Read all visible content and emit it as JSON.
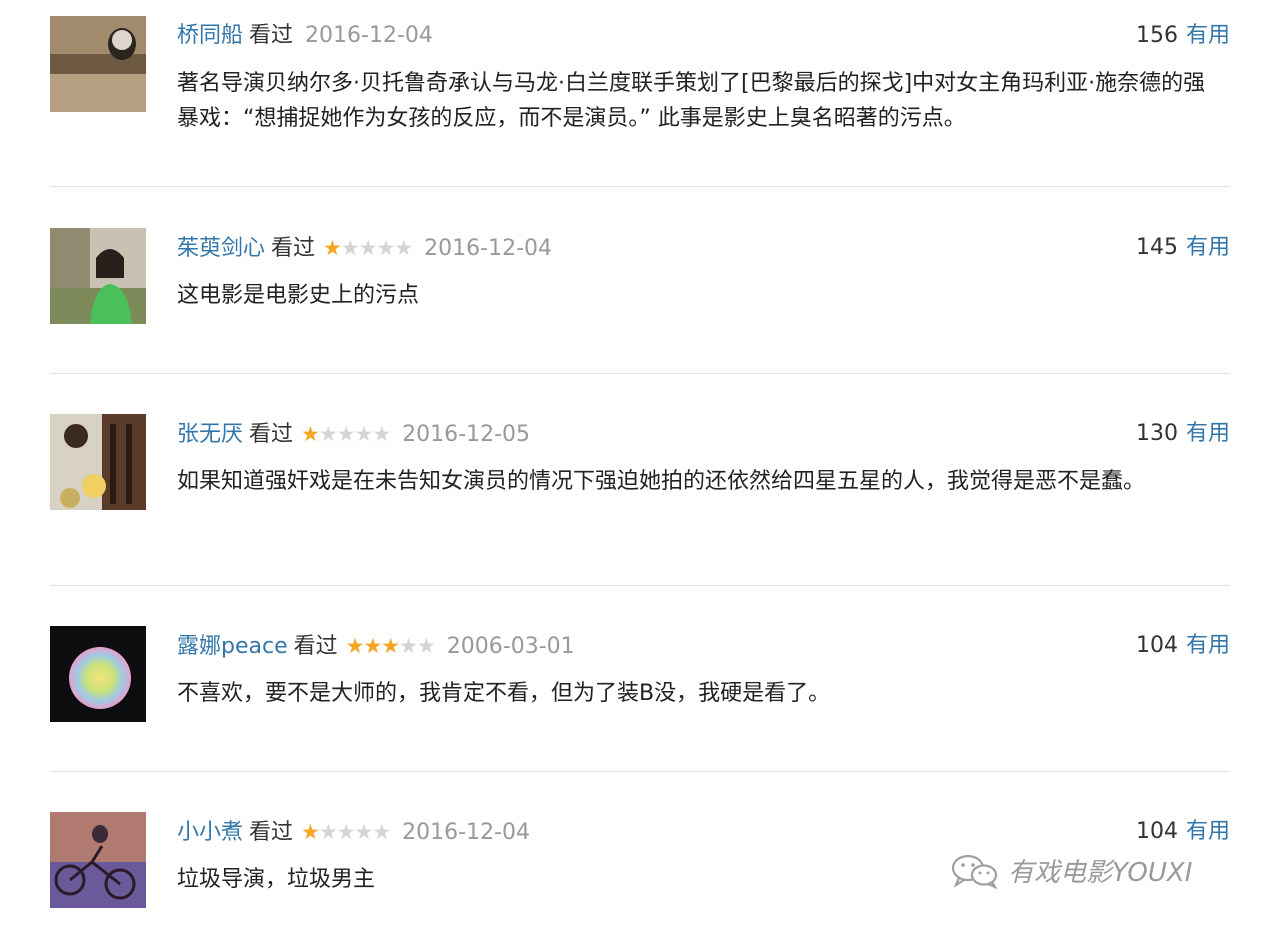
{
  "comments": [
    {
      "user": "桥同船",
      "status": "看过",
      "rating": 0,
      "date": "2016-12-04",
      "votes": "156",
      "useful_label": "有用",
      "text": "著名导演贝纳尔多·贝托鲁奇承认与马龙·白兰度联手策划了[巴黎最后的探戈]中对女主角玛利亚·施奈德的强暴戏：“想捕捉她作为女孩的反应，而不是演员。” 此事是影史上臭名昭著的污点。"
    },
    {
      "user": "茱萸剑心",
      "status": "看过",
      "rating": 1,
      "date": "2016-12-04",
      "votes": "145",
      "useful_label": "有用",
      "text": "这电影是电影史上的污点"
    },
    {
      "user": "张无厌",
      "status": "看过",
      "rating": 1,
      "date": "2016-12-05",
      "votes": "130",
      "useful_label": "有用",
      "text": "如果知道强奸戏是在未告知女演员的情况下强迫她拍的还依然给四星五星的人，我觉得是恶不是蠢。"
    },
    {
      "user": "露娜peace",
      "status": "看过",
      "rating": 3,
      "date": "2006-03-01",
      "votes": "104",
      "useful_label": "有用",
      "text": "不喜欢，要不是大师的，我肯定不看，但为了装B没，我硬是看了。"
    },
    {
      "user": "小小煮",
      "status": "看过",
      "rating": 1,
      "date": "2016-12-04",
      "votes": "104",
      "useful_label": "有用",
      "text": "垃圾导演，垃圾男主"
    }
  ],
  "watermark": {
    "text": "有戏电影YOUXI",
    "icon": "wechat-icon"
  },
  "colors": {
    "username": "#3377aa",
    "star_on": "#f5a623",
    "star_off": "#d4d4d4",
    "date": "#999999"
  }
}
